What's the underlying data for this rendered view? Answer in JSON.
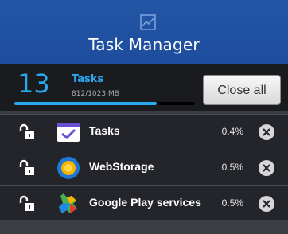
{
  "header": {
    "title": "Task Manager",
    "icon": "chart-icon"
  },
  "summary": {
    "count": "13",
    "count_label": "Tasks",
    "memory": "812/1023 MB",
    "memory_used_fraction": 0.79,
    "close_all_label": "Close all"
  },
  "tasks": [
    {
      "name": "Tasks",
      "percent": "0.4%",
      "icon": "tasks-app-icon"
    },
    {
      "name": "WebStorage",
      "percent": "0.5%",
      "icon": "webstorage-app-icon"
    },
    {
      "name": "Google Play services",
      "percent": "0.5%",
      "icon": "google-play-services-icon"
    }
  ],
  "colors": {
    "header": "#1f51a1",
    "accent": "#2aa9ee",
    "background": "#23252a"
  }
}
